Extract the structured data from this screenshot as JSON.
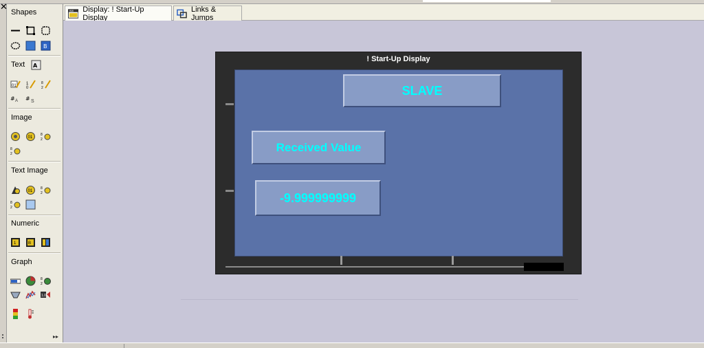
{
  "toolbox": {
    "close_glyph": "✕",
    "sections": {
      "shapes": "Shapes",
      "text": "Text",
      "image": "Image",
      "text_image": "Text Image",
      "numeric": "Numeric",
      "graph": "Graph"
    }
  },
  "tabs": [
    {
      "label": "Display: ! Start-Up Display",
      "icon": "hmi-display-icon",
      "active": true
    },
    {
      "label": "Links & Jumps",
      "icon": "links-icon",
      "active": false
    }
  ],
  "display": {
    "title": "! Start-Up Display",
    "header_box": "SLAVE",
    "label_box": "Received Value",
    "value_box": "-9.999999999",
    "text_color": "#00ffff",
    "screen_color": "#5a72a8",
    "box_color": "#889cc6"
  }
}
